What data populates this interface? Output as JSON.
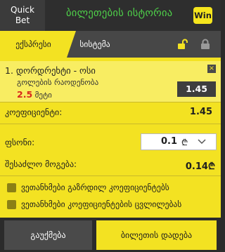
{
  "header": {
    "quickbet_line1": "Quick",
    "quickbet_line2": "Bet",
    "title": "ბილეთების ისტორია",
    "win_badge": "Win"
  },
  "tabs": {
    "express": "ექსპრესი",
    "system": "სისტემა"
  },
  "bet": {
    "match": "1. დორდრეხტი - ოსი",
    "market": "გოლების რაოდენობა",
    "selection_value": "2.5",
    "selection_label": "მეტი",
    "odds": "1.45",
    "close": "×"
  },
  "summary": {
    "coef_label": "კოეფიციენტი:",
    "coef_value": "1.45",
    "stake_label": "ფსონი:",
    "stake_value": "0.1",
    "currency": "₾",
    "win_label": "შესაძლო მოგება:",
    "win_value": "0.14₾"
  },
  "options": {
    "agree_higher": "ვეთანხმები გაზრდილ კოეფიციენტებს",
    "agree_change": "ვეთანხმები კოეფიციენტების ცვლილებას"
  },
  "buttons": {
    "clear": "გაუქმება",
    "place": "ბილეთის დადება"
  },
  "colors": {
    "accent_yellow": "#f3e222",
    "header_green": "#4fd34a",
    "selection_red": "#d8281b",
    "dark": "#2b2b2b"
  }
}
